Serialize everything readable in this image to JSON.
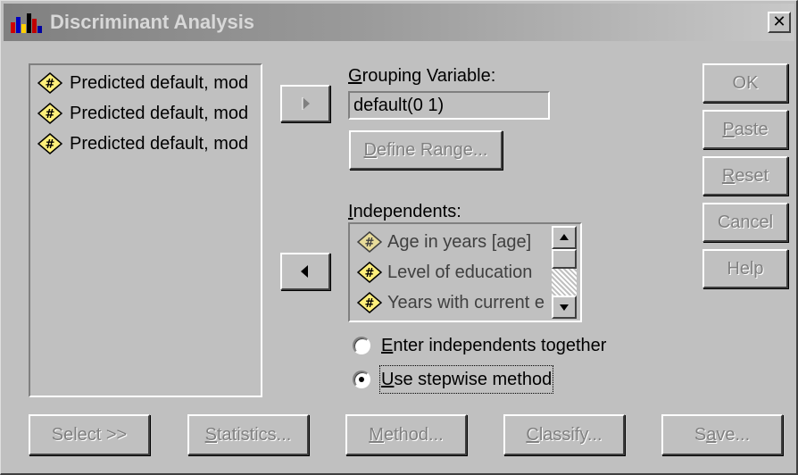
{
  "window": {
    "title": "Discriminant Analysis",
    "close_glyph": "✕",
    "title_bar_color": "#808080"
  },
  "source_list": {
    "items": [
      {
        "label": "Predicted default, mod",
        "icon": "numeric-variable-icon"
      },
      {
        "label": "Predicted default, mod",
        "icon": "numeric-variable-icon"
      },
      {
        "label": "Predicted default, mod",
        "icon": "numeric-variable-icon"
      }
    ]
  },
  "grouping": {
    "label_ul": "G",
    "label_rest": "rouping Variable:",
    "value": "default(0 1)",
    "move_icon": "right-arrow-icon"
  },
  "define_range": {
    "label_ul": "D",
    "label_rest": "efine Range..."
  },
  "independents": {
    "label_ul": "I",
    "label_rest": "ndependents:",
    "move_icon": "left-arrow-icon",
    "items": [
      {
        "label": "Age in years [age]",
        "icon": "numeric-variable-icon"
      },
      {
        "label": "Level of education",
        "icon": "numeric-variable-icon"
      },
      {
        "label": "Years with current e",
        "icon": "numeric-variable-icon"
      }
    ]
  },
  "method_options": {
    "enter": {
      "ul": "E",
      "rest": "nter independents together",
      "selected": false
    },
    "stepwise": {
      "ul": "U",
      "rest": "se stepwise method",
      "selected": true
    }
  },
  "side_buttons": {
    "ok": "OK",
    "paste": {
      "ul": "P",
      "rest": "aste"
    },
    "reset": {
      "ul": "R",
      "rest": "eset"
    },
    "cancel": "Cancel",
    "help": "Help"
  },
  "bottom_buttons": {
    "select": "Select >>",
    "statistics": {
      "ul": "S",
      "rest": "tatistics..."
    },
    "method": {
      "ul": "M",
      "rest": "ethod..."
    },
    "classify": {
      "ul": "C",
      "rest": "lassify..."
    },
    "save": {
      "pre": "S",
      "ul": "a",
      "rest": "ve..."
    }
  },
  "colors": {
    "face": "#c0c0c0",
    "disabled_text": "#808080",
    "icon_fill": "#ffef7a"
  }
}
